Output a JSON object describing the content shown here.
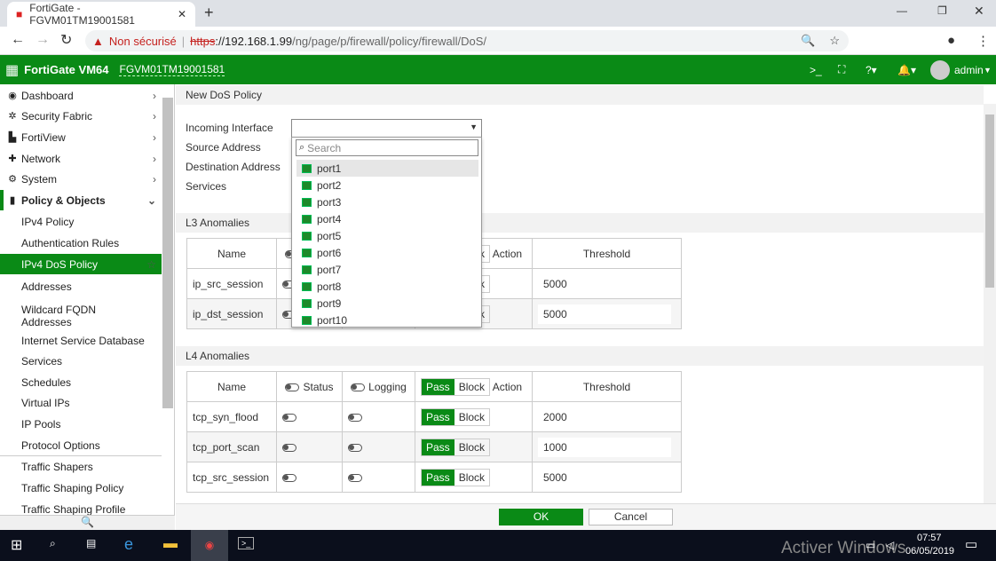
{
  "browser": {
    "tab_title": "FortiGate - FGVM01TM19001581",
    "security_label": "Non sécurisé",
    "url_scheme": "https",
    "url_host": "://192.168.1.99",
    "url_path": "/ng/page/p/firewall/policy/firewall/DoS/"
  },
  "header": {
    "product": "FortiGate VM64",
    "serial": "FGVM01TM19001581",
    "user": "admin",
    "brand_color": "#0a8a16"
  },
  "sidebar": {
    "items": [
      {
        "label": "Dashboard",
        "icon": "dashboard-icon",
        "top": true
      },
      {
        "label": "Security Fabric",
        "icon": "fabric-icon",
        "top": true
      },
      {
        "label": "FortiView",
        "icon": "chart-icon",
        "top": true
      },
      {
        "label": "Network",
        "icon": "network-icon",
        "top": true
      },
      {
        "label": "System",
        "icon": "gear-icon",
        "top": true
      },
      {
        "label": "Policy & Objects",
        "icon": "policy-icon",
        "top": true,
        "expanded": true
      },
      {
        "label": "IPv4 Policy"
      },
      {
        "label": "Authentication Rules"
      },
      {
        "label": "IPv4 DoS Policy",
        "selected": true
      },
      {
        "label": "Addresses"
      },
      {
        "label": "Wildcard FQDN Addresses"
      },
      {
        "label": "Internet Service Database"
      },
      {
        "label": "Services"
      },
      {
        "label": "Schedules"
      },
      {
        "label": "Virtual IPs"
      },
      {
        "label": "IP Pools"
      },
      {
        "label": "Protocol Options"
      },
      {
        "label": "Traffic Shapers"
      },
      {
        "label": "Traffic Shaping Policy"
      },
      {
        "label": "Traffic Shaping Profile"
      }
    ]
  },
  "page": {
    "title": "New DoS Policy",
    "form": {
      "incoming": "Incoming Interface",
      "source": "Source Address",
      "destination": "Destination Address",
      "services": "Services"
    },
    "dropdown": {
      "search_placeholder": "Search",
      "options": [
        "port1",
        "port2",
        "port3",
        "port4",
        "port5",
        "port6",
        "port7",
        "port8",
        "port9",
        "port10"
      ],
      "highlighted": "port1"
    },
    "l3": {
      "title": "L3 Anomalies",
      "columns": [
        "Name",
        "Status",
        "Logging",
        "Action",
        "Threshold"
      ],
      "rows": [
        {
          "name": "ip_src_session",
          "threshold": "5000"
        },
        {
          "name": "ip_dst_session",
          "threshold": "5000"
        }
      ]
    },
    "l4": {
      "title": "L4 Anomalies",
      "columns": [
        "Name",
        "Status",
        "Logging",
        "Action",
        "Threshold"
      ],
      "rows": [
        {
          "name": "tcp_syn_flood",
          "threshold": "2000"
        },
        {
          "name": "tcp_port_scan",
          "threshold": "1000"
        },
        {
          "name": "tcp_src_session",
          "threshold": "5000"
        }
      ]
    },
    "pass": "Pass",
    "block": "Block",
    "ok": "OK",
    "cancel": "Cancel"
  },
  "taskbar": {
    "time": "07:57",
    "date": "06/05/2019",
    "watermark": "Activer Windows"
  }
}
